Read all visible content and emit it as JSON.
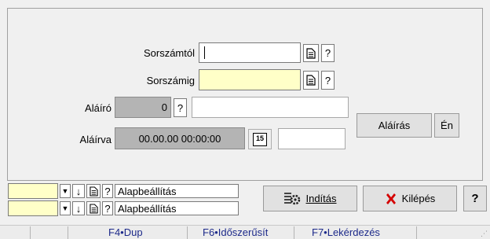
{
  "form": {
    "sorszamtol_label": "Sorszámtól",
    "sorszamtol_value": "",
    "sorszamig_label": "Sorszámig",
    "sorszamig_value": "",
    "alairo_label": "Aláíró",
    "alairo_value": "0",
    "alairo_name": "",
    "alairva_label": "Aláírva",
    "alairva_value": "00.00.00 00:00:00",
    "alairva_extra": "",
    "calendar_glyph": "15",
    "help_glyph": "?",
    "alairas_button": "Aláírás",
    "en_button": "Én"
  },
  "filters": [
    {
      "value": "",
      "preset": "Alapbeállítás"
    },
    {
      "value": "",
      "preset": "Alapbeállítás"
    }
  ],
  "actions": {
    "inditas_label": "Indítás",
    "kilepes_label": "Kilépés",
    "help_label": "?"
  },
  "function_keys": [
    "F4•Dup",
    "F6•Időszerűsít",
    "F7•Lekérdezés"
  ],
  "colors": {
    "required_field": "#ffffc8",
    "disabled_field": "#b4b4b4",
    "kilepes_icon": "#d40000",
    "fkey_text": "#1d2a8a"
  }
}
